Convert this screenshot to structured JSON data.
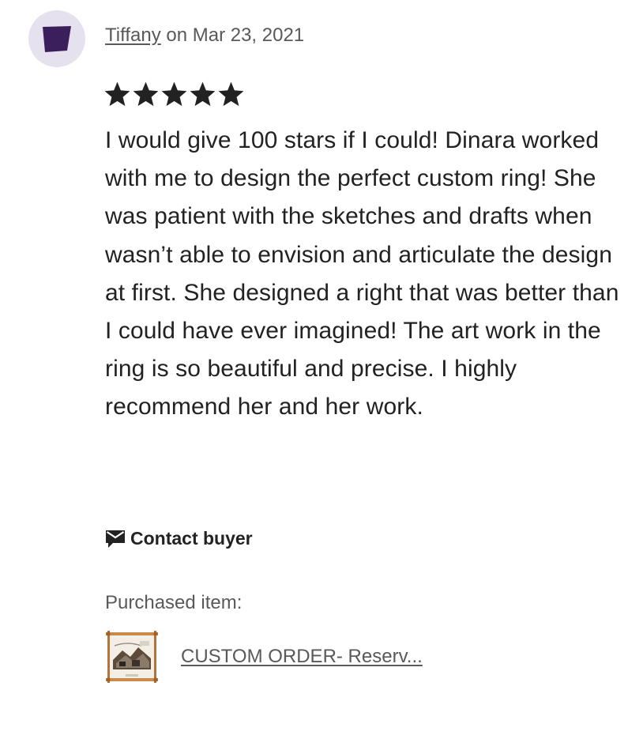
{
  "review": {
    "reviewer_name": "Tiffany",
    "byline_suffix": " on Mar 23, 2021",
    "rating": 5,
    "rating_max": 5,
    "text": "I would give 100 stars if I could! Dinara worked with me to design the perfect custom ring! She was patient with the sketches and drafts when wasn’t able to envision and articulate the design at first. She designed a right that was better than I could have ever imagined! The art work in the ring is so beautiful and precise. I highly recommend her and her work."
  },
  "actions": {
    "contact_label": "Contact buyer",
    "contact_icon": "envelope-icon"
  },
  "purchase": {
    "label": "Purchased item:",
    "item_title": "CUSTOM ORDER- Reserv..."
  },
  "colors": {
    "avatar_bg": "#e6e1ef",
    "avatar_fg": "#3b1f5c",
    "text": "#222222",
    "muted": "#595959"
  }
}
